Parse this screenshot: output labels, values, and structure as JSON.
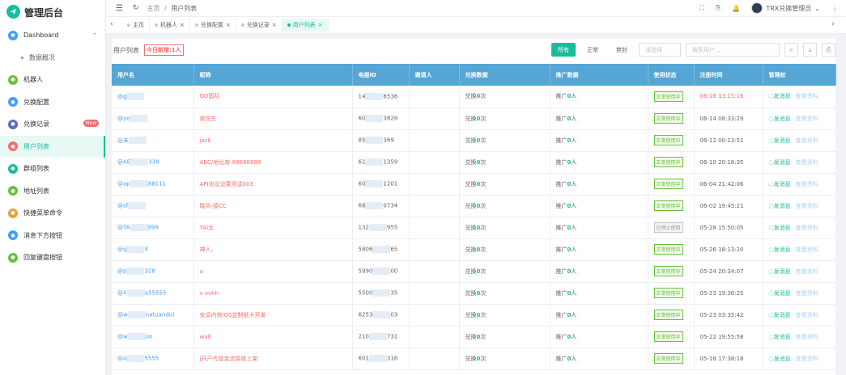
{
  "sidebar": {
    "logo": "管理后台",
    "items": [
      {
        "label": "Dashboard",
        "color": "#409eff",
        "icon": "home-icon"
      },
      {
        "label": "数据概况",
        "sub": true
      },
      {
        "label": "机器人",
        "color": "#67c23a",
        "icon": "robot-icon"
      },
      {
        "label": "兑换配置",
        "color": "#409eff",
        "icon": "settings-icon"
      },
      {
        "label": "兑换记录",
        "color": "#5d6dbe",
        "icon": "record-icon",
        "badge": "New"
      },
      {
        "label": "用户列表",
        "color": "#f56c6c",
        "icon": "user-icon",
        "active": true
      },
      {
        "label": "群组列表",
        "color": "#1abc9c",
        "icon": "group-icon"
      },
      {
        "label": "地址列表",
        "color": "#67c23a",
        "icon": "address-icon"
      },
      {
        "label": "快捷菜单命令",
        "color": "#e6a23c",
        "icon": "lightning-icon"
      },
      {
        "label": "消息下方按钮",
        "color": "#409eff",
        "icon": "button-icon"
      },
      {
        "label": "回复键盘按钮",
        "color": "#67c23a",
        "icon": "keyboard-icon"
      }
    ]
  },
  "topbar": {
    "breadcrumb_home": "主页",
    "breadcrumb_sep": "/",
    "breadcrumb_current": "用户列表",
    "user_name": "TRX兑换管理员"
  },
  "tabs": [
    {
      "label": "主页",
      "close": false
    },
    {
      "label": "机器人",
      "close": true
    },
    {
      "label": "兑换配置",
      "close": true
    },
    {
      "label": "兑换记录",
      "close": true
    },
    {
      "label": "用户列表",
      "close": true,
      "active": true
    }
  ],
  "toolbar": {
    "title": "用户列表",
    "today_new": "今日新增:1人",
    "btn_all": "所有",
    "btn_normal": "正常",
    "btn_banned": "禁封",
    "select_placeholder": "请选择",
    "search_placeholder": "搜索用户..."
  },
  "table": {
    "headers": [
      "用户名",
      "昵称",
      "电报ID",
      "邀请人",
      "兑换数据",
      "推广数据",
      "使用状态",
      "注册时间",
      "管理权"
    ],
    "send_label": "发消息",
    "view_label": "查看资料",
    "rows": [
      {
        "user": "@g",
        "nick": "GD国际",
        "tg": "14",
        "tg_end": "6536",
        "redeem": "0",
        "promo": "0",
        "status": "正常使用中",
        "time": "06-18 13:15:16",
        "time_red": true
      },
      {
        "user": "@ye",
        "nick": "夜先生",
        "tg": "60",
        "tg_end": "3828",
        "redeem": "0",
        "promo": "0",
        "status": "正常使用中",
        "time": "06-14 08:33:29"
      },
      {
        "user": "@未",
        "nick": "jack",
        "tg": "85",
        "tg_end": "369",
        "redeem": "0",
        "promo": "0",
        "status": "正常使用中",
        "time": "06-12 00:13:51"
      },
      {
        "user": "@AE",
        "user_end": "338",
        "nick": "ABC/地址库-88888888",
        "tg": "61",
        "tg_end": "1359",
        "redeem": "0",
        "promo": "0",
        "status": "正常使用中",
        "time": "06-10 20:18:35"
      },
      {
        "user": "@ap",
        "user_end": "88111",
        "nick": "API协议设置测试003",
        "tg": "60",
        "tg_end": "1201",
        "redeem": "0",
        "promo": "0",
        "status": "正常使用中",
        "time": "06-04 21:42:06"
      },
      {
        "user": "@sf",
        "nick": "晓风-接CC",
        "tg": "68",
        "tg_end": "0734",
        "redeem": "0",
        "promo": "0",
        "status": "正常使用中",
        "time": "06-02 19:45:21"
      },
      {
        "user": "@TA",
        "user_end": "999",
        "nick": "TAI太",
        "tg": "132",
        "tg_end": "955",
        "redeem": "0",
        "promo": "0",
        "status": "已停止使用",
        "off": true,
        "time": "05-28 15:50:05"
      },
      {
        "user": "@q",
        "user_end": "8",
        "nick": "神人、",
        "tg": "5806",
        "tg_end": "65",
        "redeem": "0",
        "promo": "0",
        "status": "正常使用中",
        "time": "05-26 18:13:20"
      },
      {
        "user": "@p",
        "user_end": "328",
        "nick": "a",
        "tg": "5990",
        "tg_end": "00",
        "redeem": "0",
        "promo": "0",
        "status": "正常使用中",
        "time": "05-24 20:34:07"
      },
      {
        "user": "@X",
        "user_end": "a55555",
        "nick": "v vvhh",
        "tg": "5500",
        "tg_end": "35",
        "redeem": "0",
        "promo": "0",
        "status": "正常使用中",
        "time": "05-23 19:36:25"
      },
      {
        "user": "@w",
        "user_end": "natuandui",
        "nick": "安卓内核IOS定制纸卡开发",
        "tg": "6253",
        "tg_end": "03",
        "redeem": "0",
        "promo": "0",
        "status": "正常使用中",
        "time": "05-23 03:35:42"
      },
      {
        "user": "@w",
        "user_end": "oo",
        "nick": "wall",
        "tg": "210",
        "tg_end": "731",
        "redeem": "0",
        "promo": "0",
        "status": "正常使用中",
        "time": "05-22 19:55:58"
      },
      {
        "user": "@a",
        "user_end": "5555",
        "nick": "j开户代投金流容欲上架",
        "tg": "601",
        "tg_end": "316",
        "redeem": "0",
        "promo": "0",
        "status": "正常使用中",
        "time": "05-18 17:38:18"
      }
    ]
  },
  "labels": {
    "redeem_prefix": "兑换",
    "redeem_suffix": "次",
    "promo_prefix": "推广",
    "promo_suffix": "人"
  }
}
